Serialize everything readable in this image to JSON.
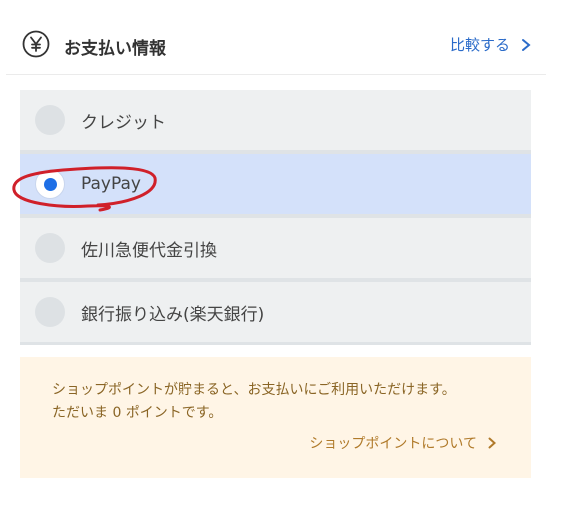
{
  "header": {
    "icon": "yen-icon",
    "title": "お支払い情報",
    "compare_link": "比較する"
  },
  "payment_options": [
    {
      "label": "クレジット",
      "selected": false
    },
    {
      "label": "PayPay",
      "selected": true
    },
    {
      "label": "佐川急便代金引換",
      "selected": false
    },
    {
      "label": "銀行振り込み(楽天銀行)",
      "selected": false
    }
  ],
  "points": {
    "line1": "ショップポイントが貯まると、お支払いにご利用いただけます。",
    "line2": "ただいま 0 ポイントです。",
    "link": "ショップポイントについて"
  },
  "colors": {
    "accent": "#1e6fe6",
    "link": "#2b6bc9",
    "selected_bg": "#d4e1fa",
    "annotation": "#d0202a",
    "points_bg": "#fff5e6"
  }
}
